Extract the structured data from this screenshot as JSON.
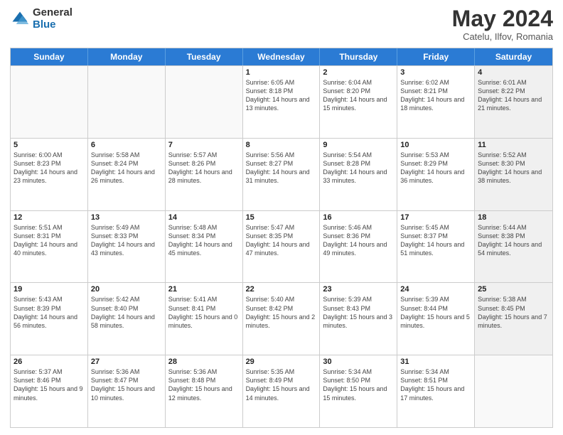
{
  "logo": {
    "general": "General",
    "blue": "Blue"
  },
  "header": {
    "month": "May 2024",
    "location": "Catelu, Ilfov, Romania"
  },
  "days": [
    "Sunday",
    "Monday",
    "Tuesday",
    "Wednesday",
    "Thursday",
    "Friday",
    "Saturday"
  ],
  "rows": [
    [
      {
        "day": "",
        "sunrise": "",
        "sunset": "",
        "daylight": "",
        "empty": true
      },
      {
        "day": "",
        "sunrise": "",
        "sunset": "",
        "daylight": "",
        "empty": true
      },
      {
        "day": "",
        "sunrise": "",
        "sunset": "",
        "daylight": "",
        "empty": true
      },
      {
        "day": "1",
        "sunrise": "Sunrise: 6:05 AM",
        "sunset": "Sunset: 8:18 PM",
        "daylight": "Daylight: 14 hours and 13 minutes.",
        "empty": false
      },
      {
        "day": "2",
        "sunrise": "Sunrise: 6:04 AM",
        "sunset": "Sunset: 8:20 PM",
        "daylight": "Daylight: 14 hours and 15 minutes.",
        "empty": false
      },
      {
        "day": "3",
        "sunrise": "Sunrise: 6:02 AM",
        "sunset": "Sunset: 8:21 PM",
        "daylight": "Daylight: 14 hours and 18 minutes.",
        "empty": false
      },
      {
        "day": "4",
        "sunrise": "Sunrise: 6:01 AM",
        "sunset": "Sunset: 8:22 PM",
        "daylight": "Daylight: 14 hours and 21 minutes.",
        "empty": false,
        "shaded": true
      }
    ],
    [
      {
        "day": "5",
        "sunrise": "Sunrise: 6:00 AM",
        "sunset": "Sunset: 8:23 PM",
        "daylight": "Daylight: 14 hours and 23 minutes.",
        "empty": false
      },
      {
        "day": "6",
        "sunrise": "Sunrise: 5:58 AM",
        "sunset": "Sunset: 8:24 PM",
        "daylight": "Daylight: 14 hours and 26 minutes.",
        "empty": false
      },
      {
        "day": "7",
        "sunrise": "Sunrise: 5:57 AM",
        "sunset": "Sunset: 8:26 PM",
        "daylight": "Daylight: 14 hours and 28 minutes.",
        "empty": false
      },
      {
        "day": "8",
        "sunrise": "Sunrise: 5:56 AM",
        "sunset": "Sunset: 8:27 PM",
        "daylight": "Daylight: 14 hours and 31 minutes.",
        "empty": false
      },
      {
        "day": "9",
        "sunrise": "Sunrise: 5:54 AM",
        "sunset": "Sunset: 8:28 PM",
        "daylight": "Daylight: 14 hours and 33 minutes.",
        "empty": false
      },
      {
        "day": "10",
        "sunrise": "Sunrise: 5:53 AM",
        "sunset": "Sunset: 8:29 PM",
        "daylight": "Daylight: 14 hours and 36 minutes.",
        "empty": false
      },
      {
        "day": "11",
        "sunrise": "Sunrise: 5:52 AM",
        "sunset": "Sunset: 8:30 PM",
        "daylight": "Daylight: 14 hours and 38 minutes.",
        "empty": false,
        "shaded": true
      }
    ],
    [
      {
        "day": "12",
        "sunrise": "Sunrise: 5:51 AM",
        "sunset": "Sunset: 8:31 PM",
        "daylight": "Daylight: 14 hours and 40 minutes.",
        "empty": false
      },
      {
        "day": "13",
        "sunrise": "Sunrise: 5:49 AM",
        "sunset": "Sunset: 8:33 PM",
        "daylight": "Daylight: 14 hours and 43 minutes.",
        "empty": false
      },
      {
        "day": "14",
        "sunrise": "Sunrise: 5:48 AM",
        "sunset": "Sunset: 8:34 PM",
        "daylight": "Daylight: 14 hours and 45 minutes.",
        "empty": false
      },
      {
        "day": "15",
        "sunrise": "Sunrise: 5:47 AM",
        "sunset": "Sunset: 8:35 PM",
        "daylight": "Daylight: 14 hours and 47 minutes.",
        "empty": false
      },
      {
        "day": "16",
        "sunrise": "Sunrise: 5:46 AM",
        "sunset": "Sunset: 8:36 PM",
        "daylight": "Daylight: 14 hours and 49 minutes.",
        "empty": false
      },
      {
        "day": "17",
        "sunrise": "Sunrise: 5:45 AM",
        "sunset": "Sunset: 8:37 PM",
        "daylight": "Daylight: 14 hours and 51 minutes.",
        "empty": false
      },
      {
        "day": "18",
        "sunrise": "Sunrise: 5:44 AM",
        "sunset": "Sunset: 8:38 PM",
        "daylight": "Daylight: 14 hours and 54 minutes.",
        "empty": false,
        "shaded": true
      }
    ],
    [
      {
        "day": "19",
        "sunrise": "Sunrise: 5:43 AM",
        "sunset": "Sunset: 8:39 PM",
        "daylight": "Daylight: 14 hours and 56 minutes.",
        "empty": false
      },
      {
        "day": "20",
        "sunrise": "Sunrise: 5:42 AM",
        "sunset": "Sunset: 8:40 PM",
        "daylight": "Daylight: 14 hours and 58 minutes.",
        "empty": false
      },
      {
        "day": "21",
        "sunrise": "Sunrise: 5:41 AM",
        "sunset": "Sunset: 8:41 PM",
        "daylight": "Daylight: 15 hours and 0 minutes.",
        "empty": false
      },
      {
        "day": "22",
        "sunrise": "Sunrise: 5:40 AM",
        "sunset": "Sunset: 8:42 PM",
        "daylight": "Daylight: 15 hours and 2 minutes.",
        "empty": false
      },
      {
        "day": "23",
        "sunrise": "Sunrise: 5:39 AM",
        "sunset": "Sunset: 8:43 PM",
        "daylight": "Daylight: 15 hours and 3 minutes.",
        "empty": false
      },
      {
        "day": "24",
        "sunrise": "Sunrise: 5:39 AM",
        "sunset": "Sunset: 8:44 PM",
        "daylight": "Daylight: 15 hours and 5 minutes.",
        "empty": false
      },
      {
        "day": "25",
        "sunrise": "Sunrise: 5:38 AM",
        "sunset": "Sunset: 8:45 PM",
        "daylight": "Daylight: 15 hours and 7 minutes.",
        "empty": false,
        "shaded": true
      }
    ],
    [
      {
        "day": "26",
        "sunrise": "Sunrise: 5:37 AM",
        "sunset": "Sunset: 8:46 PM",
        "daylight": "Daylight: 15 hours and 9 minutes.",
        "empty": false
      },
      {
        "day": "27",
        "sunrise": "Sunrise: 5:36 AM",
        "sunset": "Sunset: 8:47 PM",
        "daylight": "Daylight: 15 hours and 10 minutes.",
        "empty": false
      },
      {
        "day": "28",
        "sunrise": "Sunrise: 5:36 AM",
        "sunset": "Sunset: 8:48 PM",
        "daylight": "Daylight: 15 hours and 12 minutes.",
        "empty": false
      },
      {
        "day": "29",
        "sunrise": "Sunrise: 5:35 AM",
        "sunset": "Sunset: 8:49 PM",
        "daylight": "Daylight: 15 hours and 14 minutes.",
        "empty": false
      },
      {
        "day": "30",
        "sunrise": "Sunrise: 5:34 AM",
        "sunset": "Sunset: 8:50 PM",
        "daylight": "Daylight: 15 hours and 15 minutes.",
        "empty": false
      },
      {
        "day": "31",
        "sunrise": "Sunrise: 5:34 AM",
        "sunset": "Sunset: 8:51 PM",
        "daylight": "Daylight: 15 hours and 17 minutes.",
        "empty": false
      },
      {
        "day": "",
        "sunrise": "",
        "sunset": "",
        "daylight": "",
        "empty": true,
        "shaded": true
      }
    ]
  ]
}
